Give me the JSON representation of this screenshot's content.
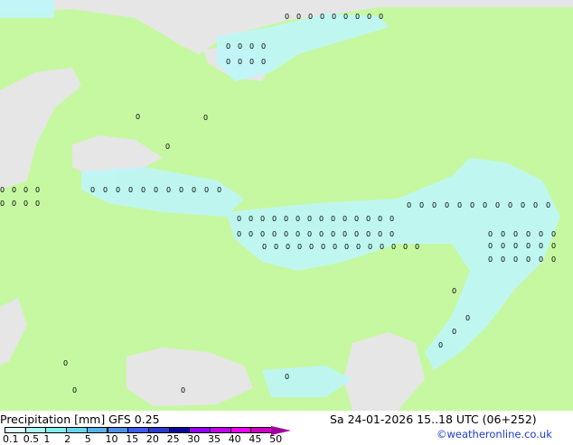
{
  "map": {
    "land_color": "#c6f8a2",
    "sea_color": "#e6e6e6",
    "precip_color": "#bef6f8",
    "marker_value": "0"
  },
  "footer": {
    "title": "Precipitation [mm]  GFS 0.25",
    "datetime": "Sa 24-01-2026 15..18 UTC (06+252)",
    "copyright": "©weatheronline.co.uk",
    "legend": [
      {
        "label": "0.1",
        "color": "#ddfcfc"
      },
      {
        "label": "0.5",
        "color": "#a6f8f8"
      },
      {
        "label": "1",
        "color": "#80eeee"
      },
      {
        "label": "2",
        "color": "#64d6ee"
      },
      {
        "label": "5",
        "color": "#54b4ea"
      },
      {
        "label": "10",
        "color": "#4c90e6"
      },
      {
        "label": "15",
        "color": "#3c5cee"
      },
      {
        "label": "20",
        "color": "#2a3ccc"
      },
      {
        "label": "25",
        "color": "#0a0a9a"
      },
      {
        "label": "30",
        "color": "#9600f2"
      },
      {
        "label": "35",
        "color": "#c200ea"
      },
      {
        "label": "40",
        "color": "#ee00f0"
      },
      {
        "label": "45",
        "color": "#cc00c0"
      },
      {
        "label": "50",
        "color": "#a000a0"
      }
    ]
  }
}
